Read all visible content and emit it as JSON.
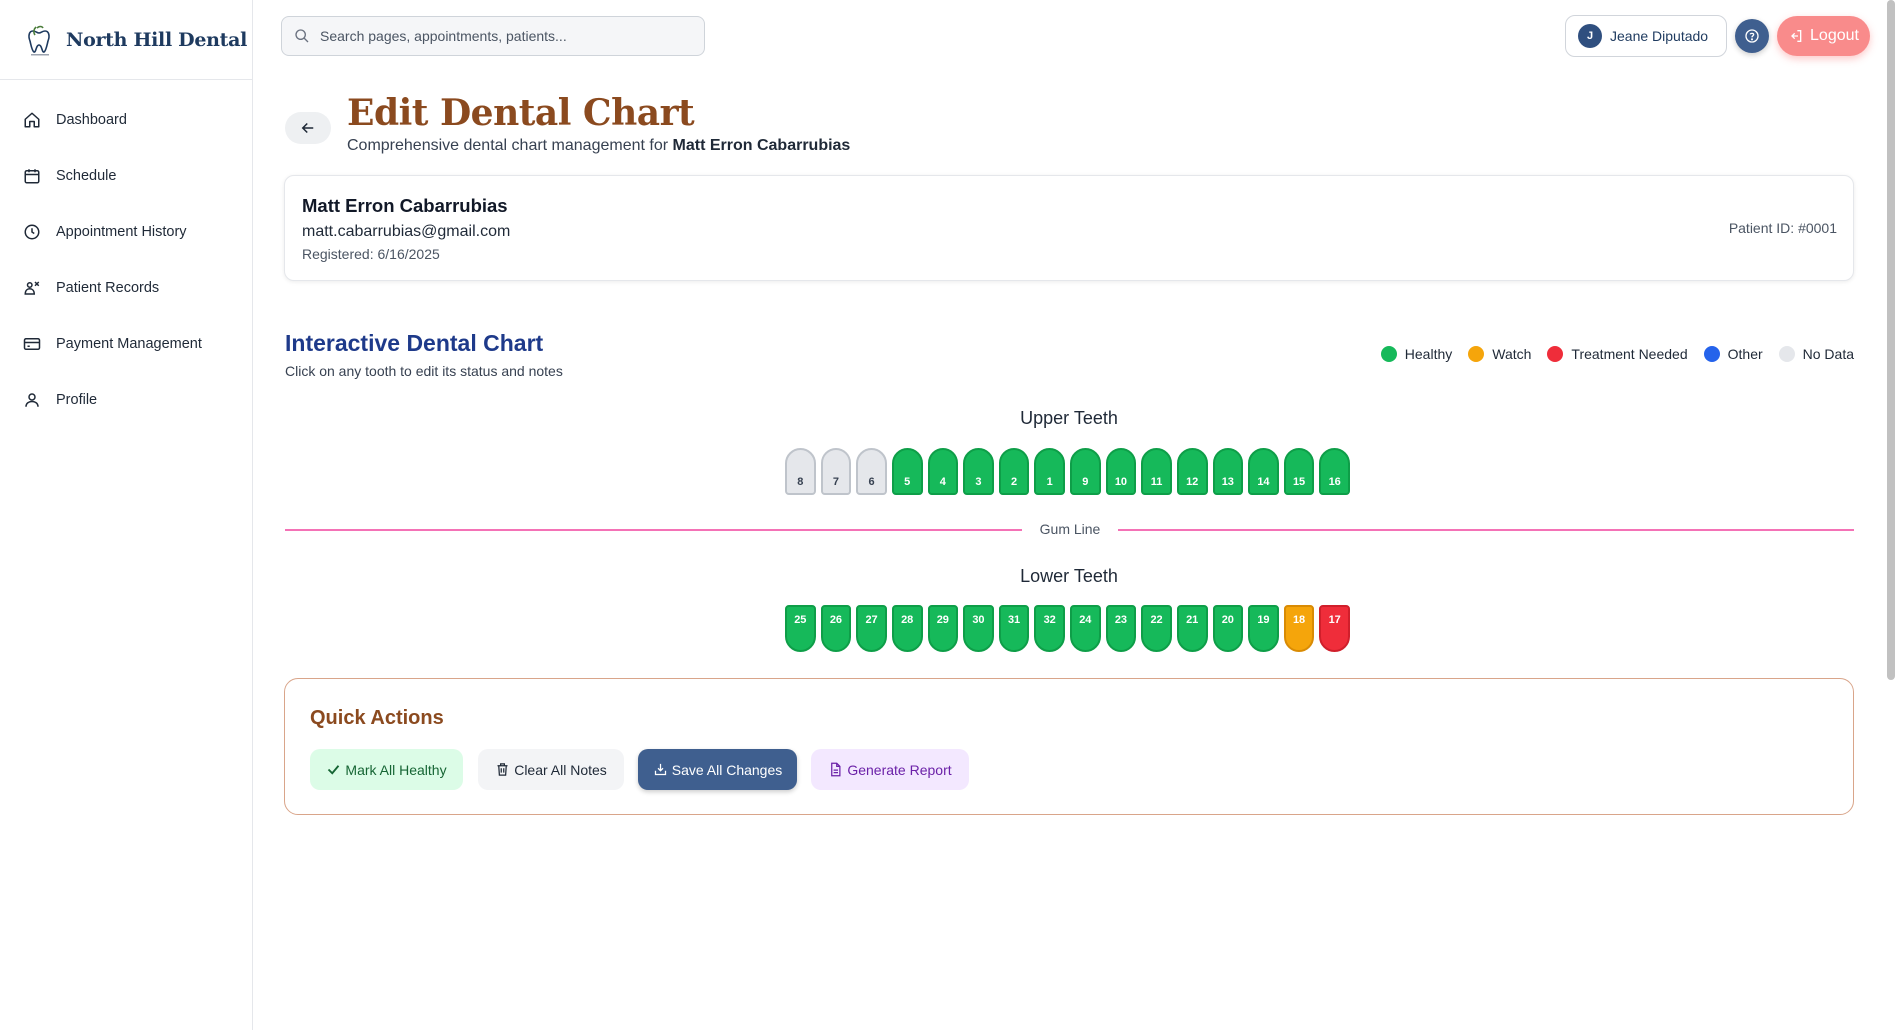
{
  "brand": {
    "name": "North Hill Dental"
  },
  "sidebar": {
    "items": [
      {
        "label": "Dashboard",
        "icon": "home-icon"
      },
      {
        "label": "Schedule",
        "icon": "calendar-icon"
      },
      {
        "label": "Appointment History",
        "icon": "clock-icon"
      },
      {
        "label": "Patient Records",
        "icon": "patient-records-icon"
      },
      {
        "label": "Payment Management",
        "icon": "credit-card-icon"
      },
      {
        "label": "Profile",
        "icon": "user-icon"
      }
    ]
  },
  "topbar": {
    "search_placeholder": "Search pages, appointments, patients...",
    "user_initial": "J",
    "user_name": "Jeane Diputado",
    "logout_label": "Logout"
  },
  "header": {
    "title": "Edit Dental Chart",
    "subtitle_prefix": "Comprehensive dental chart management for",
    "subtitle_patient": "Matt Erron Cabarrubias"
  },
  "patient": {
    "name": "Matt Erron Cabarrubias",
    "email": "matt.cabarrubias@gmail.com",
    "registered": "Registered: 6/16/2025",
    "patient_id": "Patient ID: #0001"
  },
  "chart": {
    "title": "Interactive Dental Chart",
    "subtitle": "Click on any tooth to edit its status and notes",
    "legend": [
      {
        "label": "Healthy",
        "color": "#16b95a"
      },
      {
        "label": "Watch",
        "color": "#f5a50b"
      },
      {
        "label": "Treatment Needed",
        "color": "#ef2d3a"
      },
      {
        "label": "Other",
        "color": "#2563eb"
      },
      {
        "label": "No Data",
        "color": "#e5e7eb"
      }
    ],
    "upper_label": "Upper Teeth",
    "lower_label": "Lower Teeth",
    "gum_label": "Gum Line",
    "upper_teeth": [
      {
        "number": "8",
        "status": "nodata"
      },
      {
        "number": "7",
        "status": "nodata"
      },
      {
        "number": "6",
        "status": "nodata"
      },
      {
        "number": "5",
        "status": "healthy"
      },
      {
        "number": "4",
        "status": "healthy"
      },
      {
        "number": "3",
        "status": "healthy"
      },
      {
        "number": "2",
        "status": "healthy"
      },
      {
        "number": "1",
        "status": "healthy"
      },
      {
        "number": "9",
        "status": "healthy"
      },
      {
        "number": "10",
        "status": "healthy"
      },
      {
        "number": "11",
        "status": "healthy"
      },
      {
        "number": "12",
        "status": "healthy"
      },
      {
        "number": "13",
        "status": "healthy"
      },
      {
        "number": "14",
        "status": "healthy"
      },
      {
        "number": "15",
        "status": "healthy"
      },
      {
        "number": "16",
        "status": "healthy"
      }
    ],
    "lower_teeth": [
      {
        "number": "25",
        "status": "healthy"
      },
      {
        "number": "26",
        "status": "healthy"
      },
      {
        "number": "27",
        "status": "healthy"
      },
      {
        "number": "28",
        "status": "healthy"
      },
      {
        "number": "29",
        "status": "healthy"
      },
      {
        "number": "30",
        "status": "healthy"
      },
      {
        "number": "31",
        "status": "healthy"
      },
      {
        "number": "32",
        "status": "healthy"
      },
      {
        "number": "24",
        "status": "healthy"
      },
      {
        "number": "23",
        "status": "healthy"
      },
      {
        "number": "22",
        "status": "healthy"
      },
      {
        "number": "21",
        "status": "healthy"
      },
      {
        "number": "20",
        "status": "healthy"
      },
      {
        "number": "19",
        "status": "healthy"
      },
      {
        "number": "18",
        "status": "watch"
      },
      {
        "number": "17",
        "status": "treat"
      }
    ]
  },
  "quick_actions": {
    "title": "Quick Actions",
    "mark_healthy": "Mark All Healthy",
    "clear_notes": "Clear All Notes",
    "save_changes": "Save All Changes",
    "generate_report": "Generate Report"
  }
}
